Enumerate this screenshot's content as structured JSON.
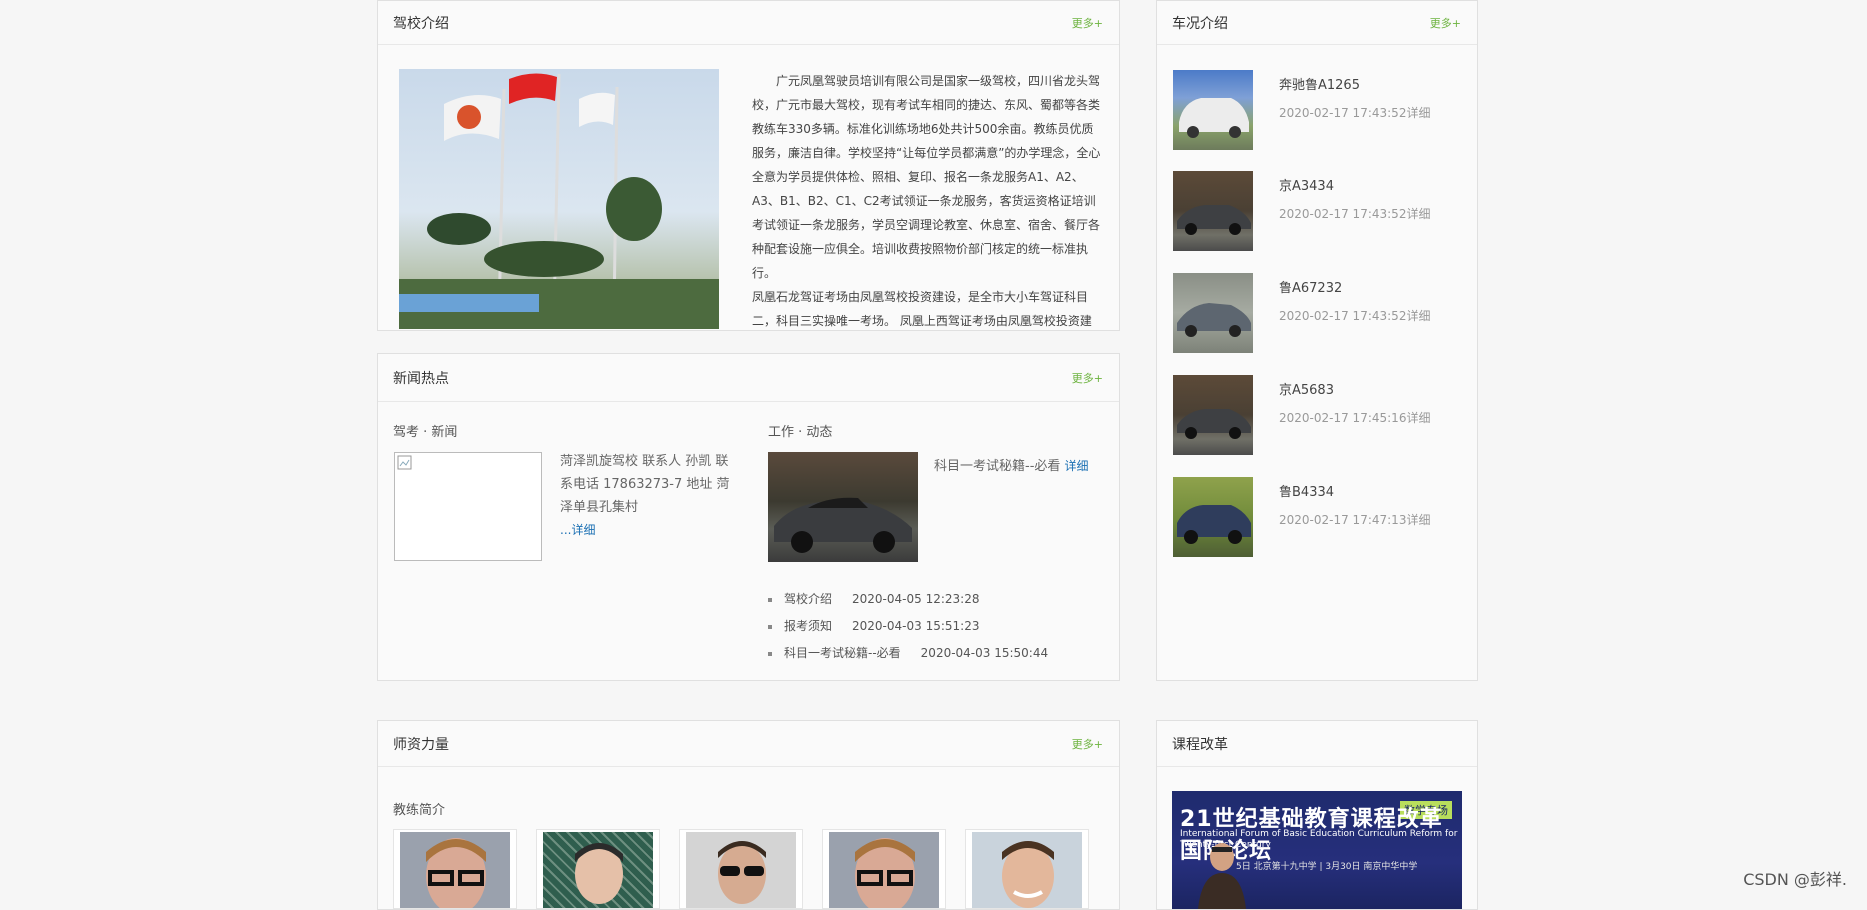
{
  "intro": {
    "title": "驾校介绍",
    "more": "更多+",
    "paragraph1": "广元凤凰驾驶员培训有限公司是国家一级驾校，四川省龙头驾校，广元市最大驾校，现有考试车相同的捷达、东风、蜀都等各类教练车330多辆。标准化训练场地6处共计500余亩。教练员优质服务，廉洁自律。学校坚持“让每位学员都满意”的办学理念，全心全意为学员提供体检、照相、复印、报名一条龙服务A1、A2、A3、B1、B2、C1、C2考试领证一条龙服务，客货运资格证培训考试领证一条龙服务，学员空调理论教室、休息室、宿舍、餐厅各种配套设施一应俱全。培训收费按照物价部门核定的统一标准执行。",
    "paragraph2": "凤凰石龙驾证考场由凤凰驾校投资建设，是全市大小车驾证科目二，科目三实操唯一考场。 凤凰上西驾证考场由凤凰驾校投资建"
  },
  "cars": {
    "title": "车况介绍",
    "more": "更多+",
    "items": [
      {
        "name": "奔驰鲁A1265",
        "date": "2020-02-17 17:43:52详细"
      },
      {
        "name": "京A3434",
        "date": "2020-02-17 17:43:52详细"
      },
      {
        "name": "鲁A67232",
        "date": "2020-02-17 17:43:52详细"
      },
      {
        "name": "京A5683",
        "date": "2020-02-17 17:45:16详细"
      },
      {
        "name": "鲁B4334",
        "date": "2020-02-17 17:47:13详细"
      }
    ]
  },
  "news": {
    "title": "新闻热点",
    "more": "更多+",
    "left_heading": "驾考 · 新闻",
    "left_text": "菏泽凯旋驾校 联系人 孙凯 联系电话 17863273-7 地址 菏泽单县孔集村",
    "left_link": "...详细",
    "right_heading": "工作 · 动态",
    "right_text": "科目一考试秘籍--必看",
    "right_link": "详细",
    "list": [
      {
        "title": "驾校介绍",
        "date": "2020-04-05 12:23:28"
      },
      {
        "title": "报考须知",
        "date": "2020-04-03 15:51:23"
      },
      {
        "title": "科目一考试秘籍--必看",
        "date": "2020-04-03 15:50:44"
      }
    ]
  },
  "teachers": {
    "title": "师资力量",
    "more": "更多+",
    "subheading": "教练简介"
  },
  "course": {
    "title": "课程改革",
    "banner_tag": "数学专场",
    "banner_title": "21世纪基础教育课程改革国际论坛",
    "banner_sub": "International Forum of Basic Education Curriculum Reform for Twenty-first Century",
    "banner_foot": "5日 北京第十九中学 | 3月30日 南京中华中学"
  },
  "watermark": "CSDN @彭祥."
}
